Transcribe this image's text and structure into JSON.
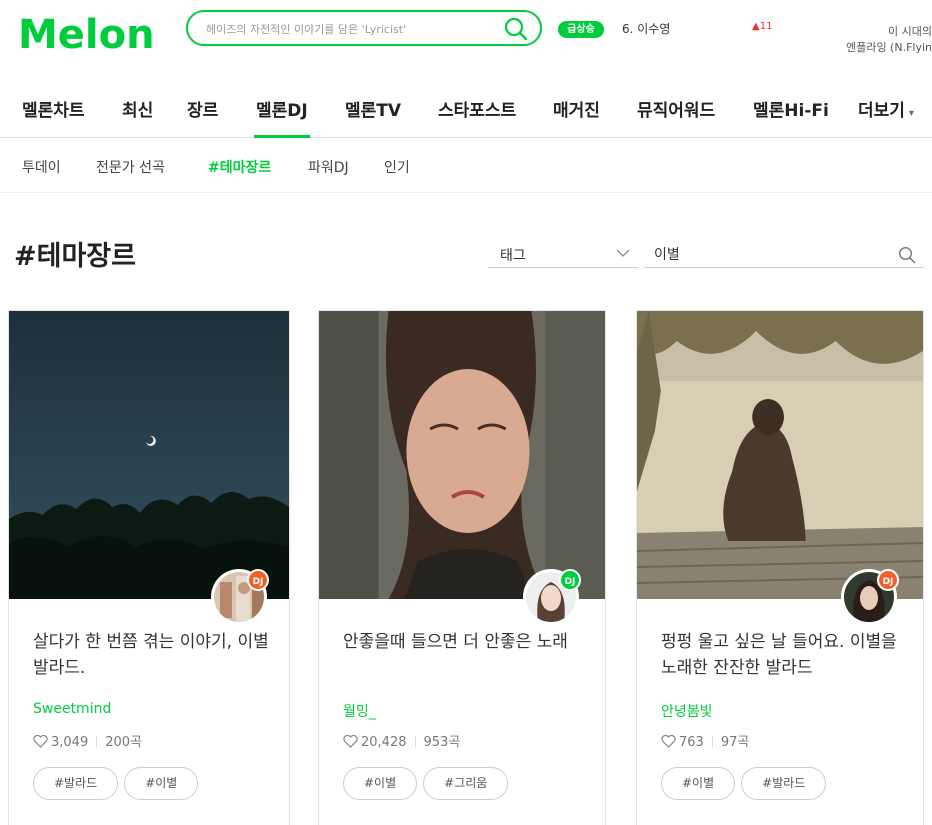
{
  "brand": {
    "logo_text": "Melon",
    "accent": "#00cd3c"
  },
  "search": {
    "placeholder": "헤이즈의 자전적인 이야기를 담은 'Lyricist'"
  },
  "realtime": {
    "badge": "급상승",
    "item": "6. 이수영",
    "change": "11"
  },
  "promo": {
    "line1": "이 시대의 ",
    "line2": "엔플라잉 (N.Flyin"
  },
  "gnb": {
    "items": [
      {
        "label": "멜론차트"
      },
      {
        "label": "최신"
      },
      {
        "label": "장르"
      },
      {
        "label": "멜론DJ"
      },
      {
        "label": "멜론TV"
      },
      {
        "label": "스타포스트"
      },
      {
        "label": "매거진"
      },
      {
        "label": "뮤직어워드"
      },
      {
        "label": "멜론Hi-Fi"
      },
      {
        "label": "더보기"
      }
    ],
    "active": "멜론DJ"
  },
  "lnb": {
    "items": [
      {
        "label": "투데이"
      },
      {
        "label": "전문가 선곡"
      },
      {
        "label": "#테마장르"
      },
      {
        "label": "파워DJ"
      },
      {
        "label": "인기"
      }
    ],
    "active": "#테마장르"
  },
  "page": {
    "title": "#테마장르"
  },
  "filter": {
    "select_label": "태그",
    "keyword": "이별"
  },
  "cards": [
    {
      "title": "살다가 한 번쯤 겪는 이야기, 이별 발라드.",
      "dj": "Sweetmind",
      "likes": "3,049",
      "songs": "200곡",
      "tags": [
        "#발라드",
        "#이별"
      ],
      "dj_badge": "DJ"
    },
    {
      "title": "안좋을때 들으면 더 안좋은 노래",
      "dj": "월밍_",
      "likes": "20,428",
      "songs": "953곡",
      "tags": [
        "#이별",
        "#그리움"
      ],
      "dj_badge": "DJ"
    },
    {
      "title": "펑펑 울고 싶은 날 들어요. 이별을 노래한 잔잔한 발라드",
      "dj": "안녕봄빛",
      "likes": "763",
      "songs": "97곡",
      "tags": [
        "#이별",
        "#발라드"
      ],
      "dj_badge": "DJ"
    }
  ]
}
